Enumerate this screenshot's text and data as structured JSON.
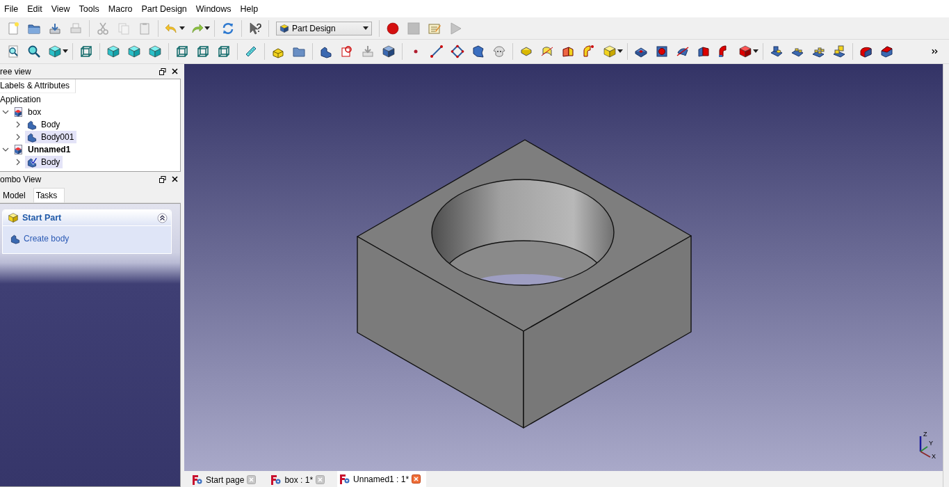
{
  "menu": [
    "File",
    "Edit",
    "View",
    "Tools",
    "Macro",
    "Part Design",
    "Windows",
    "Help"
  ],
  "workbench_selector": {
    "value": "Part Design"
  },
  "tree_view": {
    "title": "ree view",
    "tab": "Labels & Attributes",
    "root": "Application",
    "items": [
      {
        "label": "box",
        "expanded": true,
        "active": false,
        "selected": false,
        "children": [
          {
            "label": "Body",
            "expanded": false,
            "active": false,
            "selected": false
          },
          {
            "label": "Body001",
            "expanded": false,
            "active": false,
            "selected": true
          }
        ]
      },
      {
        "label": "Unnamed1",
        "expanded": true,
        "active": true,
        "selected": false,
        "children": [
          {
            "label": "Body",
            "expanded": false,
            "active": true,
            "selected": true
          }
        ]
      }
    ]
  },
  "combo_view": {
    "title": "ombo View",
    "tabs": [
      {
        "label": "Model",
        "selected": false
      },
      {
        "label": "Tasks",
        "selected": true
      }
    ],
    "task_panel": {
      "title": "Start Part",
      "expanded": true,
      "actions": [
        "Create body"
      ]
    }
  },
  "axis_labels": [
    "Z",
    "Y",
    "X"
  ],
  "document_tabs": [
    {
      "label": "Start page",
      "selected": false
    },
    {
      "label": "box : 1*",
      "selected": false
    },
    {
      "label": "Unnamed1 : 1*",
      "selected": true
    }
  ]
}
